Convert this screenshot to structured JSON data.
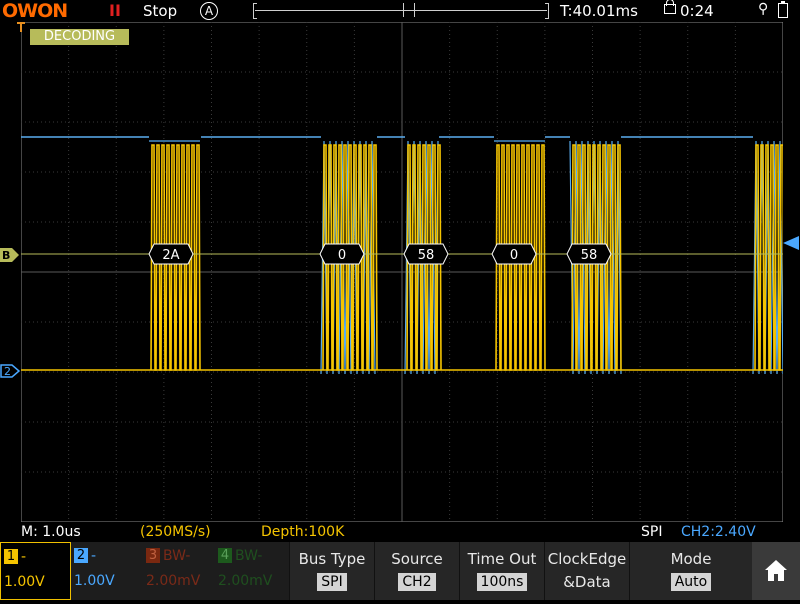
{
  "topbar": {
    "logo": "OWON",
    "run_icon": "II",
    "run_state": "Stop",
    "trigger_mode": "A",
    "trigger_time": "T:40.01ms",
    "clock": "0:24"
  },
  "screen": {
    "status_label": "DECODING",
    "bus_marker": "B",
    "ch2_marker": "2",
    "decoded_bytes": [
      "2A",
      "0",
      "58",
      "0",
      "58"
    ]
  },
  "status": {
    "timebase": "M: 1.0us",
    "sample_rate": "(250MS/s)",
    "depth": "Depth:100K",
    "protocol": "SPI",
    "trigger_level": "CH2:2.40V"
  },
  "channels": [
    {
      "num": "1",
      "bw": "-",
      "value": "1.00V",
      "color": "#f5c400"
    },
    {
      "num": "2",
      "bw": "-",
      "value": "1.00V",
      "color": "#4aa8ff"
    },
    {
      "num": "3",
      "bw": "BW-",
      "value": "2.00mV",
      "color": "#b03a1a"
    },
    {
      "num": "4",
      "bw": "BW-",
      "value": "2.00mV",
      "color": "#2a8a2a"
    }
  ],
  "menu": {
    "bus_type_label": "Bus Type",
    "bus_type_value": "SPI",
    "source_label": "Source",
    "source_value": "CH2",
    "timeout_label": "Time Out",
    "timeout_value": "100ns",
    "clock_edge_label": "ClockEdge",
    "clock_edge_value": "&Data",
    "mode_label": "Mode",
    "mode_value": "Auto"
  },
  "colors": {
    "ch1_yellow": "#f5c400",
    "ch2_blue": "#5aaef0",
    "decode_bg": "#b7bb5a",
    "brand_orange": "#ff6a00"
  }
}
